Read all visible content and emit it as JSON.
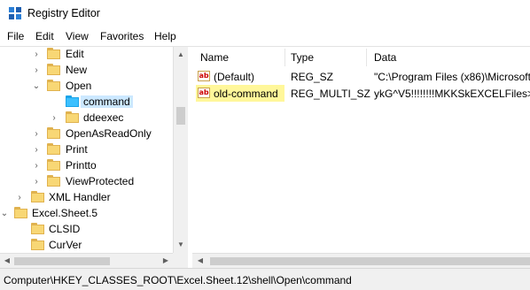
{
  "window": {
    "title": "Registry Editor"
  },
  "menu": {
    "items": [
      "File",
      "Edit",
      "View",
      "Favorites",
      "Help"
    ]
  },
  "tree": {
    "items": [
      {
        "label": "Edit",
        "expanded": false,
        "selected": false
      },
      {
        "label": "New",
        "expanded": false,
        "selected": false
      },
      {
        "label": "Open",
        "expanded": true,
        "selected": false
      },
      {
        "label": "command",
        "expanded": null,
        "selected": true
      },
      {
        "label": "ddeexec",
        "expanded": false,
        "selected": false
      },
      {
        "label": "OpenAsReadOnly",
        "expanded": false,
        "selected": false
      },
      {
        "label": "Print",
        "expanded": false,
        "selected": false
      },
      {
        "label": "Printto",
        "expanded": false,
        "selected": false
      },
      {
        "label": "ViewProtected",
        "expanded": false,
        "selected": false
      },
      {
        "label": "XML Handler",
        "expanded": false,
        "selected": false
      },
      {
        "label": "Excel.Sheet.5",
        "expanded": true,
        "selected": false
      },
      {
        "label": "CLSID",
        "expanded": null,
        "selected": false
      },
      {
        "label": "CurVer",
        "expanded": null,
        "selected": false
      }
    ]
  },
  "list": {
    "headers": {
      "name": "Name",
      "type": "Type",
      "data": "Data"
    },
    "rows": [
      {
        "name": "(Default)",
        "type": "REG_SZ",
        "data": "\"C:\\Program Files (x86)\\Microsoft",
        "highlight": false
      },
      {
        "name": "old-command",
        "type": "REG_MULTI_SZ",
        "data": "ykG^V5!!!!!!!!MKKSkEXCELFiles>V",
        "highlight": true
      }
    ]
  },
  "status": {
    "path": "Computer\\HKEY_CLASSES_ROOT\\Excel.Sheet.12\\shell\\Open\\command"
  },
  "icons": {
    "app": "registry-editor-icon",
    "value": "string-value-icon",
    "folder": "folder-icon"
  },
  "colors": {
    "selection": "#cce8ff",
    "highlight": "#fff79a",
    "folder": "#f8d775",
    "selected_folder": "#3cc0ff"
  }
}
